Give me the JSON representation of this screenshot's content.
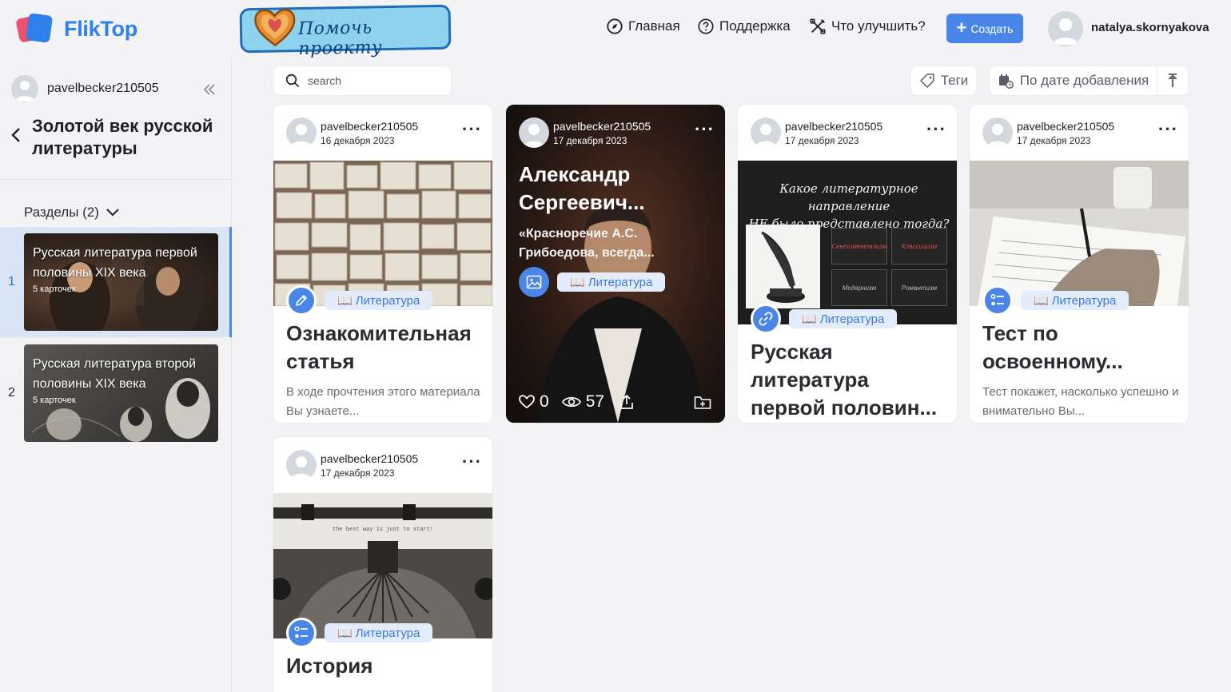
{
  "header": {
    "logo_text": "FlikTop",
    "help_text": "Помочь проекту",
    "nav": {
      "home": "Главная",
      "support": "Поддержка",
      "improve": "Что улучшить?"
    },
    "create_label": "Создать",
    "user_name": "natalya.skornyakova"
  },
  "sidebar": {
    "user_name": "pavelbecker210505",
    "title": "Золотой век русской литературы",
    "sections_label": "Разделы (2)",
    "sections": [
      {
        "num": "1",
        "title": "Русская литература первой половины XIX века",
        "count": "5 карточек",
        "active": true
      },
      {
        "num": "2",
        "title": "Русская литература второй половины XIX века",
        "count": "5 карточек",
        "active": false
      }
    ]
  },
  "toolbar": {
    "search_placeholder": "search",
    "tags_label": "Теги",
    "sort_label": "По дате добавления"
  },
  "cards": [
    {
      "author": "pavelbecker210505",
      "date": "16 декабря 2023",
      "tag": "Литература",
      "title": "Ознакомительная статья",
      "desc": "В ходе прочтения этого материала Вы узнаете...",
      "type": "pencil-icon"
    },
    {
      "author": "pavelbecker210505",
      "date": "17 декабря 2023",
      "tag": "Литература",
      "title": "Александр Сергеевич...",
      "desc": "«Красноречие А.С. Грибоедова, всегда...",
      "type": "image-icon",
      "likes": "0",
      "views": "57"
    },
    {
      "author": "pavelbecker210505",
      "date": "17 декабря 2023",
      "tag": "Литература",
      "title": "Русская литература первой половин...",
      "type": "link-icon",
      "image_text": {
        "line1": "Какое литературное направление",
        "line2": "НЕ было представлено тогда?",
        "opt1": "Сентиментализм",
        "opt2": "Классицизм",
        "opt3": "Модернизм",
        "opt4": "Романтизм"
      }
    },
    {
      "author": "pavelbecker210505",
      "date": "17 декабря 2023",
      "tag": "Литература",
      "title": "Тест по освоенному...",
      "desc": "Тест покажет, насколько успешно и внимательно Вы...",
      "type": "quiz-icon"
    },
    {
      "author": "pavelbecker210505",
      "date": "17 декабря 2023",
      "tag": "Литература",
      "title": "История",
      "type": "quiz-icon",
      "image_text": "the best way is just to start!"
    }
  ],
  "colors": {
    "accent": "#4a86e8",
    "brand": "#2f80ed",
    "tag_bg": "#e3ecfb"
  }
}
